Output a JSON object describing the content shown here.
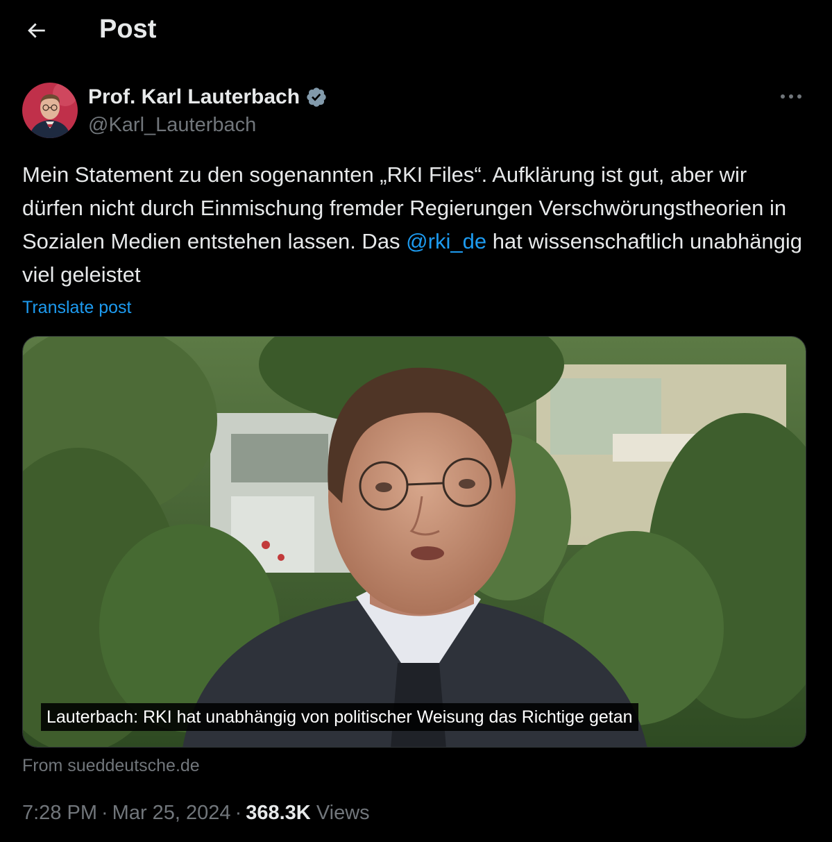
{
  "header": {
    "title": "Post",
    "back_icon": "arrow-left-icon"
  },
  "author": {
    "name": "Prof. Karl Lauterbach",
    "handle": "@Karl_Lauterbach",
    "verified_icon": "verified-badge-icon",
    "verified_color": "#829aab"
  },
  "post": {
    "text_1": "Mein Statement zu den sogenannten „RKI Files“. Aufklärung ist gut, aber wir dürfen nicht durch Einmischung fremder Regierungen Verschwörungstheorien in Sozialen Medien entstehen lassen. Das ",
    "mention": "@rki_de",
    "text_2": " hat wissenschaftlich unabhängig viel geleistet",
    "translate_label": "Translate post"
  },
  "media": {
    "caption": "Lauterbach: RKI hat unabhängig von politischer Weisung das Richtige getan",
    "source": "From sueddeutsche.de"
  },
  "meta": {
    "time": "7:28 PM",
    "separator": "·",
    "date": "Mar 25, 2024",
    "views_count": "368.3K",
    "views_label": "Views"
  },
  "colors": {
    "background": "#000000",
    "text": "#e7e9ea",
    "muted": "#71767b",
    "link": "#1d9bf0"
  }
}
